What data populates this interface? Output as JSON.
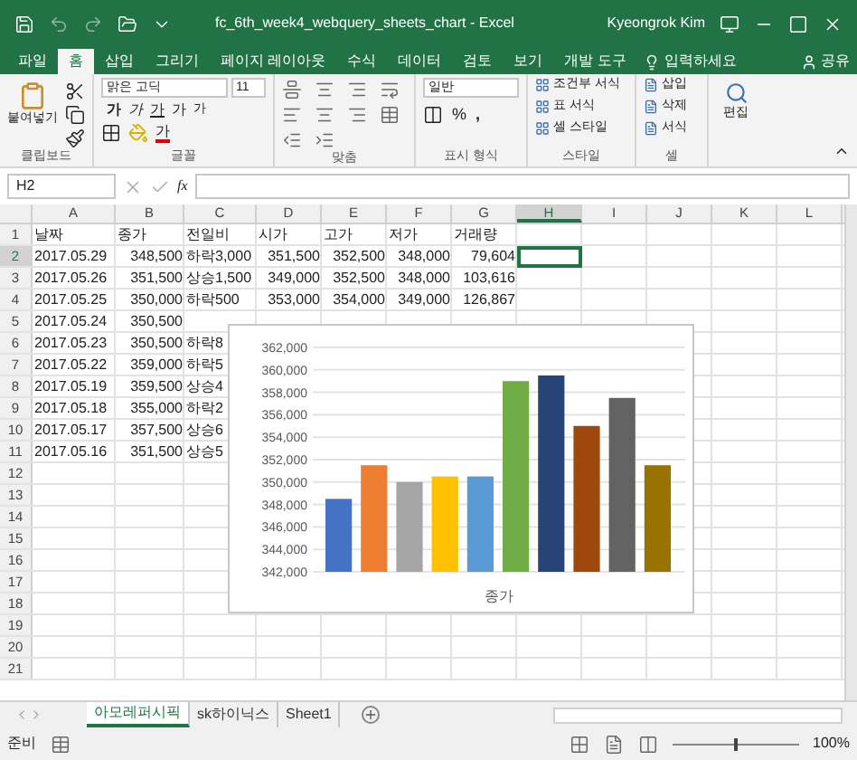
{
  "window": {
    "title": "fc_6th_week4_webquery_sheets_chart  -  Excel",
    "user": "Kyeongrok Kim"
  },
  "ribbon_tabs": [
    {
      "label": "파일",
      "selected": false
    },
    {
      "label": "홈",
      "selected": true
    },
    {
      "label": "삽입",
      "selected": false
    },
    {
      "label": "그리기",
      "selected": false
    },
    {
      "label": "페이지 레이아웃",
      "selected": false
    },
    {
      "label": "수식",
      "selected": false
    },
    {
      "label": "데이터",
      "selected": false
    },
    {
      "label": "검토",
      "selected": false
    },
    {
      "label": "보기",
      "selected": false
    },
    {
      "label": "개발 도구",
      "selected": false
    }
  ],
  "tell_me": "입력하세요",
  "share": "공유",
  "ribbon": {
    "clipboard": {
      "paste": "붙여넣기",
      "label": "클립보드"
    },
    "font": {
      "name": "맑은 고딕",
      "size": "11",
      "format_buttons": [
        {
          "kind": "bold",
          "label": "가"
        },
        {
          "kind": "italic",
          "label": "가"
        },
        {
          "kind": "underline",
          "label": "가"
        },
        {
          "kind": "grow",
          "label": "가"
        },
        {
          "kind": "shrink",
          "label": "가"
        }
      ],
      "font_color": "가",
      "label": "글꼴"
    },
    "alignment": {
      "label": "맞춤"
    },
    "number": {
      "format": "일반",
      "percent": "%",
      "comma": ",",
      "label": "표시 형식"
    },
    "styles": {
      "items": [
        "조건부 서식",
        "표 서식",
        "셀 스타일"
      ],
      "label": "스타일"
    },
    "cells": {
      "items": [
        "삽입",
        "삭제",
        "서식"
      ],
      "label": "셀"
    },
    "editing": {
      "label": "편집"
    }
  },
  "formula_bar": {
    "name_box": "H2",
    "fx": "fx"
  },
  "sheet": {
    "columns": [
      {
        "label": "A",
        "selected": false
      },
      {
        "label": "B",
        "selected": false
      },
      {
        "label": "C",
        "selected": false
      },
      {
        "label": "D",
        "selected": false
      },
      {
        "label": "E",
        "selected": false
      },
      {
        "label": "F",
        "selected": false
      },
      {
        "label": "G",
        "selected": false
      },
      {
        "label": "H",
        "selected": true
      },
      {
        "label": "I",
        "selected": false
      },
      {
        "label": "J",
        "selected": false
      },
      {
        "label": "K",
        "selected": false
      },
      {
        "label": "L",
        "selected": false
      }
    ],
    "rows": [
      {
        "number": "1",
        "selected": false,
        "cells": [
          "날짜",
          "종가",
          "전일비",
          "시가",
          "고가",
          "저가",
          "거래량"
        ]
      },
      {
        "number": "2",
        "selected": true,
        "cells": [
          "2017.05.29",
          "348,500",
          "하락3,000",
          "351,500",
          "352,500",
          "348,000",
          "79,604"
        ]
      },
      {
        "number": "3",
        "selected": false,
        "cells": [
          "2017.05.26",
          "351,500",
          "상승1,500",
          "349,000",
          "352,500",
          "348,000",
          "103,616"
        ]
      },
      {
        "number": "4",
        "selected": false,
        "cells": [
          "2017.05.25",
          "350,000",
          "하락500",
          "353,000",
          "354,000",
          "349,000",
          "126,867"
        ]
      },
      {
        "number": "5",
        "selected": false,
        "cells": [
          "2017.05.24",
          "350,500"
        ]
      },
      {
        "number": "6",
        "selected": false,
        "cells": [
          "2017.05.23",
          "350,500",
          "하락8"
        ]
      },
      {
        "number": "7",
        "selected": false,
        "cells": [
          "2017.05.22",
          "359,000",
          "하락5"
        ]
      },
      {
        "number": "8",
        "selected": false,
        "cells": [
          "2017.05.19",
          "359,500",
          "상승4"
        ]
      },
      {
        "number": "9",
        "selected": false,
        "cells": [
          "2017.05.18",
          "355,000",
          "하락2"
        ]
      },
      {
        "number": "10",
        "selected": false,
        "cells": [
          "2017.05.17",
          "357,500",
          "상승6"
        ]
      },
      {
        "number": "11",
        "selected": false,
        "cells": [
          "2017.05.16",
          "351,500",
          "상승5"
        ]
      },
      {
        "number": "12",
        "selected": false
      },
      {
        "number": "13",
        "selected": false
      },
      {
        "number": "14",
        "selected": false
      },
      {
        "number": "15",
        "selected": false
      },
      {
        "number": "16",
        "selected": false
      },
      {
        "number": "17",
        "selected": false
      },
      {
        "number": "18",
        "selected": false
      },
      {
        "number": "19",
        "selected": false
      },
      {
        "number": "20",
        "selected": false
      },
      {
        "number": "21",
        "selected": false
      }
    ],
    "chart": {
      "chart_data": {
        "type": "bar",
        "grid": true,
        "xlabel": "종가",
        "ylim": [
          342000,
          362000
        ],
        "yticks": [
          {
            "value": 342000,
            "label": "342,000"
          },
          {
            "value": 344000,
            "label": "344,000"
          },
          {
            "value": 346000,
            "label": "346,000"
          },
          {
            "value": 348000,
            "label": "348,000"
          },
          {
            "value": 350000,
            "label": "350,000"
          },
          {
            "value": 352000,
            "label": "352,000"
          },
          {
            "value": 354000,
            "label": "354,000"
          },
          {
            "value": 356000,
            "label": "356,000"
          },
          {
            "value": 358000,
            "label": "358,000"
          },
          {
            "value": 360000,
            "label": "360,000"
          },
          {
            "value": 362000,
            "label": "362,000"
          }
        ],
        "series": [
          {
            "color": "#4472c4",
            "values": [
              348500
            ]
          },
          {
            "color": "#ed7d31",
            "values": [
              351500
            ]
          },
          {
            "color": "#a5a5a5",
            "values": [
              350000
            ]
          },
          {
            "color": "#ffc000",
            "values": [
              350500
            ]
          },
          {
            "color": "#5b9bd5",
            "values": [
              350500
            ]
          },
          {
            "color": "#70ad47",
            "values": [
              359000
            ]
          },
          {
            "color": "#264478",
            "values": [
              359500
            ]
          },
          {
            "color": "#9e480e",
            "values": [
              355000
            ]
          },
          {
            "color": "#636363",
            "values": [
              357500
            ]
          },
          {
            "color": "#997300",
            "values": [
              351500
            ]
          }
        ]
      }
    }
  },
  "sheet_tabs": [
    {
      "label": "아모레퍼시픽",
      "selected": true
    },
    {
      "label": "sk하이닉스",
      "selected": false
    },
    {
      "label": "Sheet1",
      "selected": false
    }
  ],
  "status_bar": {
    "text": "준비",
    "zoom_slider": {
      "level": 0.5
    },
    "zoom": "100%"
  }
}
